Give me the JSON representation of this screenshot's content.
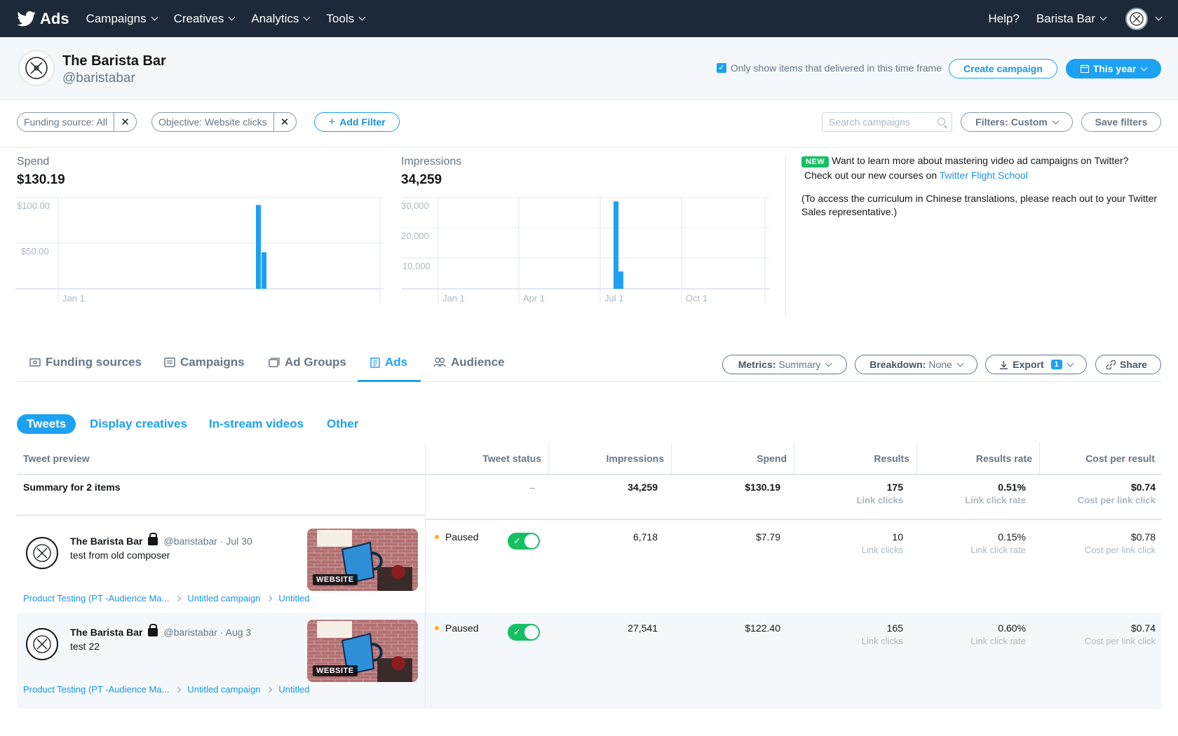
{
  "nav": {
    "brand": "Ads",
    "items": [
      {
        "label": "Campaigns"
      },
      {
        "label": "Creatives"
      },
      {
        "label": "Analytics"
      },
      {
        "label": "Tools"
      }
    ],
    "help": "Help?",
    "account": "Barista Bar"
  },
  "account_header": {
    "name": "The Barista Bar",
    "handle": "@baristabar",
    "delivered_toggle_label": "Only show items that delivered in this time frame",
    "create_campaign": "Create campaign",
    "time_frame": "This year"
  },
  "filters": {
    "chips": [
      {
        "label": "Funding source: All"
      },
      {
        "label": "Objective: Website clicks"
      }
    ],
    "add_filter": "Add Filter",
    "search_placeholder": "Search campaigns",
    "filters_custom": "Filters: Custom",
    "save_filters": "Save filters"
  },
  "metrics": {
    "spend": {
      "label": "Spend",
      "value": "$130.19"
    },
    "impressions": {
      "label": "Impressions",
      "value": "34,259"
    }
  },
  "chart_data": [
    {
      "type": "bar",
      "title": "Spend",
      "ytick_labels": [
        "$100.00",
        "$50.00"
      ],
      "ylim": [
        0,
        100
      ],
      "xtick_labels": [
        "Jan 1"
      ],
      "series": [
        {
          "values": [
            92,
            40
          ]
        }
      ]
    },
    {
      "type": "bar",
      "title": "Impressions",
      "ytick_labels": [
        "30,000",
        "20,000",
        "10,000"
      ],
      "ylim": [
        0,
        30000
      ],
      "xtick_labels": [
        "Jan 1",
        "Apr 1",
        "Jul 1",
        "Oct 1"
      ],
      "series": [
        {
          "values": [
            28800,
            5700
          ]
        }
      ]
    }
  ],
  "promo": {
    "badge": "NEW",
    "line1": "Want to learn more about mastering video ad campaigns on Twitter?",
    "line2_prefix": "Check out our new courses on ",
    "line2_link": "Twitter Flight School",
    "line3": "(To access the curriculum in Chinese translations, please reach out to your Twitter Sales representative.)"
  },
  "tabs": [
    {
      "label": "Funding sources",
      "icon": "funding-icon"
    },
    {
      "label": "Campaigns",
      "icon": "campaigns-icon"
    },
    {
      "label": "Ad Groups",
      "icon": "adgroups-icon"
    },
    {
      "label": "Ads",
      "icon": "ads-icon"
    },
    {
      "label": "Audience",
      "icon": "audience-icon"
    }
  ],
  "toolbar": {
    "metrics_key": "Metrics:",
    "metrics_val": "Summary",
    "breakdown_key": "Breakdown:",
    "breakdown_val": "None",
    "export": "Export",
    "export_count": "1",
    "share": "Share"
  },
  "subtabs": [
    {
      "label": "Tweets"
    },
    {
      "label": "Display creatives"
    },
    {
      "label": "In-stream videos"
    },
    {
      "label": "Other"
    }
  ],
  "table": {
    "headers": [
      "Tweet preview",
      "Tweet status",
      "Impressions",
      "Spend",
      "Results",
      "Results rate",
      "Cost per result"
    ],
    "summary": {
      "label": "Summary for 2 items",
      "status": "–",
      "impressions": "34,259",
      "spend": "$130.19",
      "results": "175",
      "results_sub": "Link clicks",
      "rate": "0.51%",
      "rate_sub": "Link click rate",
      "cost": "$0.74",
      "cost_sub": "Cost per link click"
    },
    "rows": [
      {
        "name": "The Barista Bar",
        "meta": "@baristabar · Jul 30",
        "text": "test from old composer",
        "thumb_label": "WEBSITE",
        "crumb1": "Product Testing (PT -Audience Ma...",
        "crumb2": "Untitled campaign",
        "crumb3": "Untitled",
        "status": "Paused",
        "impressions": "6,718",
        "spend": "$7.79",
        "results": "10",
        "results_sub": "Link clicks",
        "rate": "0.15%",
        "rate_sub": "Link click rate",
        "cost": "$0.78",
        "cost_sub": "Cost per link click"
      },
      {
        "name": "The Barista Bar",
        "meta": "@baristabar · Aug 3",
        "text": "test 22",
        "thumb_label": "WEBSITE",
        "crumb1": "Product Testing (PT -Audience Ma...",
        "crumb2": "Untitled campaign",
        "crumb3": "Untitled",
        "status": "Paused",
        "impressions": "27,541",
        "spend": "$122.40",
        "results": "165",
        "results_sub": "Link clicks",
        "rate": "0.60%",
        "rate_sub": "Link click rate",
        "cost": "$0.74",
        "cost_sub": "Cost per link click"
      }
    ]
  },
  "colors": {
    "accent": "#1da1f2",
    "nav_bg": "#1c2938",
    "toggle_on": "#17bf63",
    "paused": "#ffad1f"
  }
}
